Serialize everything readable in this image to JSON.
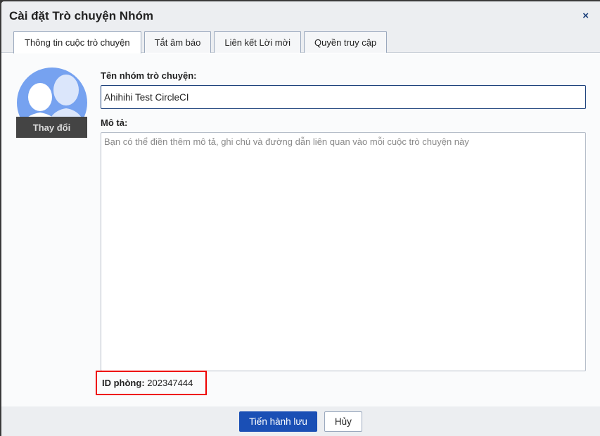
{
  "dialog": {
    "title": "Cài đặt Trò chuyện Nhóm",
    "close": "×"
  },
  "tabs": [
    "Thông tin cuộc trò chuyện",
    "Tắt âm báo",
    "Liên kết Lời mời",
    "Quyền truy cập"
  ],
  "avatar": {
    "change_label": "Thay đổi"
  },
  "form": {
    "name_label": "Tên nhóm trò chuyện:",
    "name_value": "Ahihihi Test CircleCI",
    "desc_label": "Mô tả:",
    "desc_placeholder": "Bạn có thể điền thêm mô tả, ghi chú và đường dẫn liên quan vào mỗi cuộc trò chuyện này",
    "room_id_label": "ID phòng:",
    "room_id_value": "202347444"
  },
  "footer": {
    "save": "Tiến hành lưu",
    "cancel": "Hủy"
  }
}
